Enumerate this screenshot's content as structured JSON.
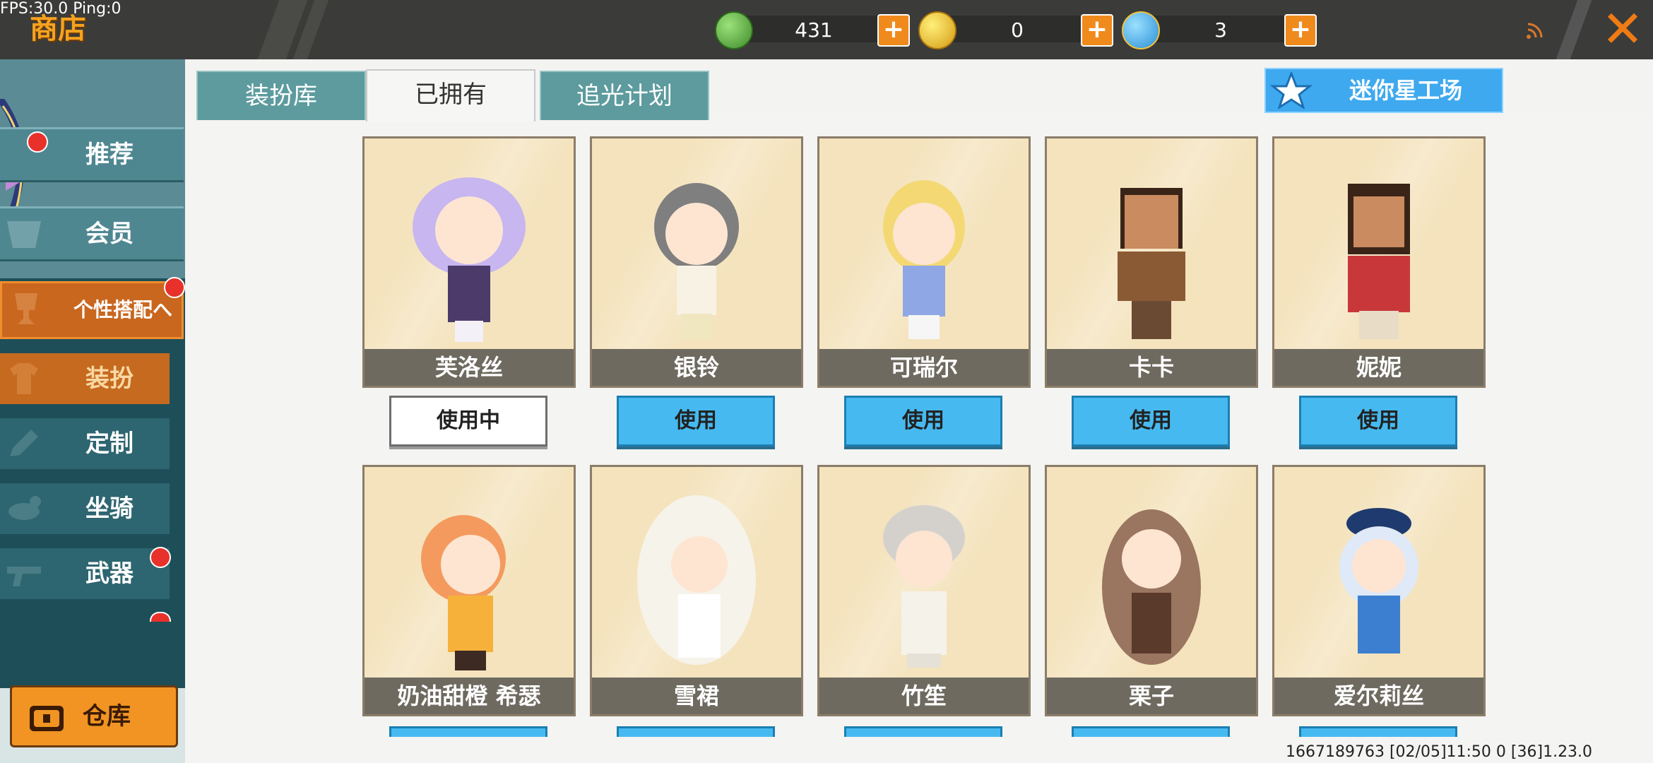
{
  "debug": {
    "fps": "FPS:30.0  Ping:0"
  },
  "header": {
    "title": "商店",
    "currencies": [
      {
        "icon": "green-gem-icon",
        "value": "431",
        "color": "#5fb043"
      },
      {
        "icon": "gold-coin-icon",
        "value": "0",
        "color": "#e9b621"
      },
      {
        "icon": "blue-coin-icon",
        "value": "3",
        "color": "#3fa9ef"
      }
    ]
  },
  "sidebar": {
    "items": [
      {
        "label": "推荐",
        "badge": true
      },
      {
        "label": "会员",
        "badge": false
      },
      {
        "label": "个性搭配へ",
        "badge": true
      },
      {
        "label": "装扮",
        "badge": false
      },
      {
        "label": "定制",
        "badge": false
      },
      {
        "label": "坐骑",
        "badge": false
      },
      {
        "label": "武器",
        "badge": true
      }
    ],
    "warehouse": "仓库"
  },
  "tabs": [
    {
      "label": "装扮库"
    },
    {
      "label": "已拥有"
    },
    {
      "label": "追光计划"
    }
  ],
  "star_workshop": "迷你星工场",
  "skins": [
    {
      "name": "芙洛丝",
      "button": "使用中"
    },
    {
      "name": "银铃",
      "button": "使用"
    },
    {
      "name": "可瑞尔",
      "button": "使用"
    },
    {
      "name": "卡卡",
      "button": "使用"
    },
    {
      "name": "妮妮",
      "button": "使用"
    },
    {
      "name": "奶油甜橙 希瑟",
      "button": ""
    },
    {
      "name": "雪裙",
      "button": ""
    },
    {
      "name": "竹笙",
      "button": ""
    },
    {
      "name": "栗子",
      "button": ""
    },
    {
      "name": "爱尔莉丝",
      "button": ""
    }
  ],
  "footer": "1667189763    [02/05]11:50 0    [36]1.23.0"
}
